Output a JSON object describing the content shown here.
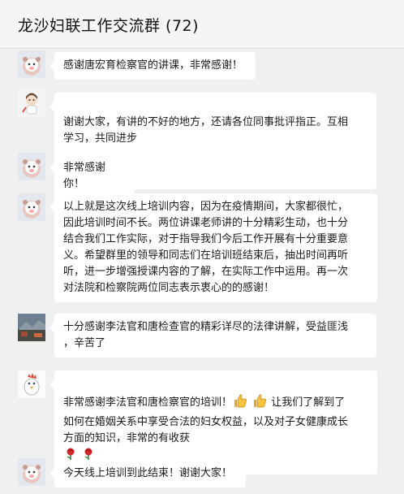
{
  "window": {
    "title": "龙沙妇联工作交流群 (72)"
  },
  "messages": [
    {
      "avatar": "cartoon-pig-avatar",
      "text": "感谢唐宏育检察官的讲课，非常感谢！"
    },
    {
      "avatar": "cartoon-girl-avatar",
      "text_before": "谢谢大家，有讲的不好的地方，还请各位同事批评指正。互相\n学习，共同进步",
      "emoji": "smile-emoji"
    },
    {
      "avatar": "cartoon-pig-avatar",
      "text": "非常感谢你！"
    },
    {
      "avatar": "cartoon-pig-avatar",
      "text": "以上就是这次线上培训内容，因为在疫情期间，大家都很忙，\n因此培训时间不长。两位讲课老师讲的十分精彩生动，也十分\n结合我们工作实际，对于指导我们今后工作开展有十分重要意\n义。希望群里的领导和同志们在培训班结束后，抽出时间再听\n听，进一步增强授课内容的了解，在实际工作中运用。再一次\n对法院和检察院两位同志表示衷心的的感谢！"
    },
    {
      "avatar": "photo-avatar",
      "text": "十分感谢李法官和唐检查官的精彩详尽的法律讲解，受益匪浅\n，辛苦了"
    },
    {
      "avatar": "cartoon-chicken-avatar",
      "text_a": "非常感谢李法官和唐检察官的培训！",
      "thumbs": "thumbs-up-emoji",
      "text_b": "让我们了解到了\n如何在婚姻关系中享受合法的妇女权益，以及对子女健康成长\n方面的知识，非常的有收获",
      "rose": "rose-emoji"
    },
    {
      "avatar": "cartoon-pig-avatar",
      "text": "今天线上培训到此结束！谢谢大家！"
    }
  ]
}
